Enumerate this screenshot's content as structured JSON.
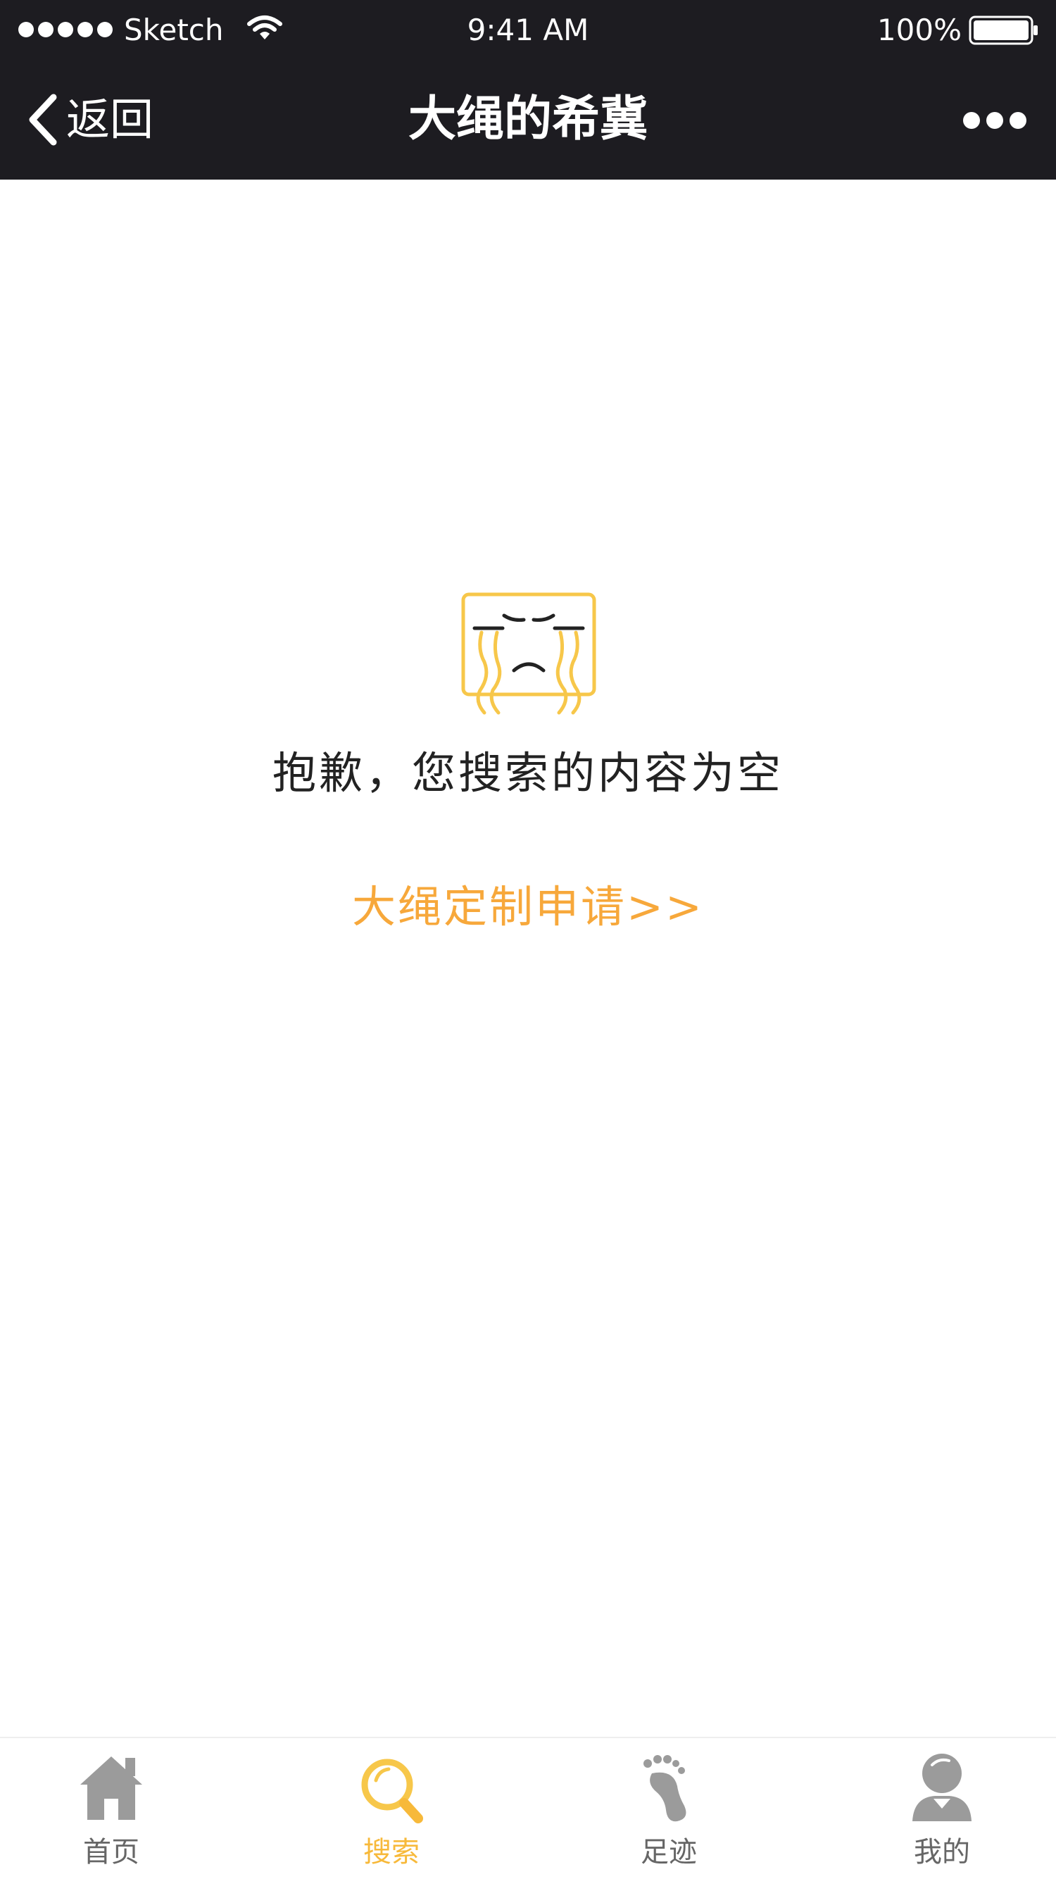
{
  "status_bar": {
    "carrier": "Sketch",
    "time": "9:41 AM",
    "battery": "100%"
  },
  "nav": {
    "back_label": "返回",
    "title": "大绳的希冀"
  },
  "empty_state": {
    "message": "抱歉，您搜索的内容为空",
    "apply_link": "大绳定制申请>>"
  },
  "tabs": [
    {
      "label": "首页",
      "icon": "home-icon",
      "active": false
    },
    {
      "label": "搜索",
      "icon": "search-icon",
      "active": true
    },
    {
      "label": "足迹",
      "icon": "footprint-icon",
      "active": false
    },
    {
      "label": "我的",
      "icon": "user-icon",
      "active": false
    }
  ],
  "colors": {
    "nav_background": "#1d1c21",
    "accent": "#f7b93a",
    "link": "#f7a83b",
    "tab_inactive": "#9b9b9b"
  }
}
